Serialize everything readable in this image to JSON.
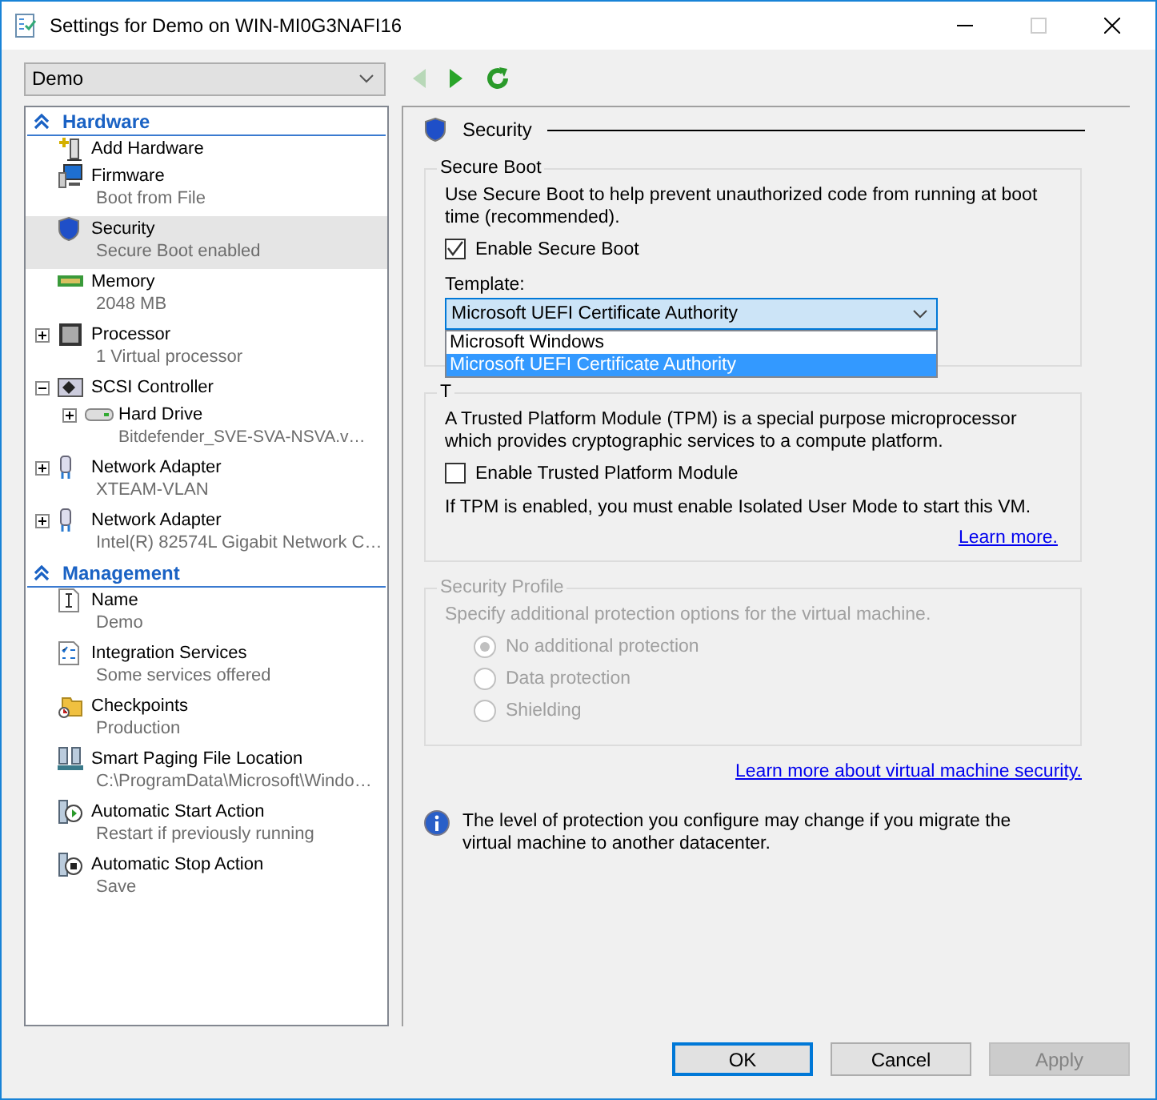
{
  "window": {
    "title": "Settings for Demo on WIN-MI0G3NAFI16"
  },
  "vm_selector": {
    "value": "Demo"
  },
  "toolbar": [
    {
      "kind": "back",
      "disabled": true
    },
    {
      "kind": "forward",
      "disabled": false
    },
    {
      "kind": "refresh",
      "disabled": false
    }
  ],
  "sidebar": {
    "sections": [
      {
        "title": "Hardware",
        "expanded": true,
        "items": [
          {
            "name": "Add Hardware",
            "selected": false
          },
          {
            "name": "Firmware",
            "sub": "Boot from File",
            "selected": false
          },
          {
            "name": "Security",
            "sub": "Secure Boot enabled",
            "selected": true
          },
          {
            "name": "Memory",
            "sub": "2048 MB",
            "selected": false
          },
          {
            "name": "Processor",
            "sub": "1 Virtual processor",
            "selected": false,
            "expanded": false
          },
          {
            "name": "SCSI Controller",
            "selected": false,
            "expanded": true,
            "children": [
              {
                "name": "Hard Drive",
                "sub": "Bitdefender_SVE-SVA-NSVA.v…",
                "selected": false,
                "expanded": false
              }
            ]
          },
          {
            "name": "Network Adapter",
            "sub": "XTEAM-VLAN",
            "selected": false,
            "expanded": false
          },
          {
            "name": "Network Adapter",
            "sub": "Intel(R) 82574L Gigabit Network C…",
            "selected": false,
            "expanded": false
          }
        ]
      },
      {
        "title": "Management",
        "expanded": true,
        "items": [
          {
            "name": "Name",
            "sub": "Demo",
            "selected": false
          },
          {
            "name": "Integration Services",
            "sub": "Some services offered",
            "selected": false
          },
          {
            "name": "Checkpoints",
            "sub": "Production",
            "selected": false
          },
          {
            "name": "Smart Paging File Location",
            "sub": "C:\\ProgramData\\Microsoft\\Windo…",
            "selected": false
          },
          {
            "name": "Automatic Start Action",
            "sub": "Restart if previously running",
            "selected": false
          },
          {
            "name": "Automatic Stop Action",
            "sub": "Save",
            "selected": false
          }
        ]
      }
    ]
  },
  "page": {
    "title": "Security",
    "secure_boot": {
      "title": "Secure Boot",
      "description": "Use Secure Boot to help prevent unauthorized code from running at boot time (recommended).",
      "checkbox": {
        "label": "Enable Secure Boot",
        "checked": true
      },
      "template": {
        "label": "Template:",
        "value": "Microsoft UEFI Certificate Authority",
        "expanded": true,
        "options": [
          {
            "label": "Microsoft Windows",
            "selected": false
          },
          {
            "label": "Microsoft UEFI Certificate Authority",
            "selected": true
          }
        ]
      }
    },
    "tpm": {
      "title": "T",
      "description": "A Trusted Platform Module (TPM) is a special purpose microprocessor which provides cryptographic services to a compute platform.",
      "checkbox": {
        "label": "Enable Trusted Platform Module",
        "checked": false
      },
      "note": "If TPM is enabled, you must enable Isolated User Mode to start this VM.",
      "link": "Learn more."
    },
    "security_profile": {
      "title": "Security Profile",
      "disabled": true,
      "description": "Specify additional protection options for the virtual machine.",
      "options": [
        {
          "label": "No additional protection",
          "selected": true
        },
        {
          "label": "Data protection",
          "selected": false
        },
        {
          "label": "Shielding",
          "selected": false
        }
      ]
    },
    "link": "Learn more about virtual machine security.",
    "info": "The level of protection you configure may change if you migrate the virtual machine to another datacenter."
  },
  "buttons": [
    {
      "label": "OK",
      "default": true,
      "disabled": false
    },
    {
      "label": "Cancel",
      "default": false,
      "disabled": false
    },
    {
      "label": "Apply",
      "default": false,
      "disabled": true
    }
  ]
}
